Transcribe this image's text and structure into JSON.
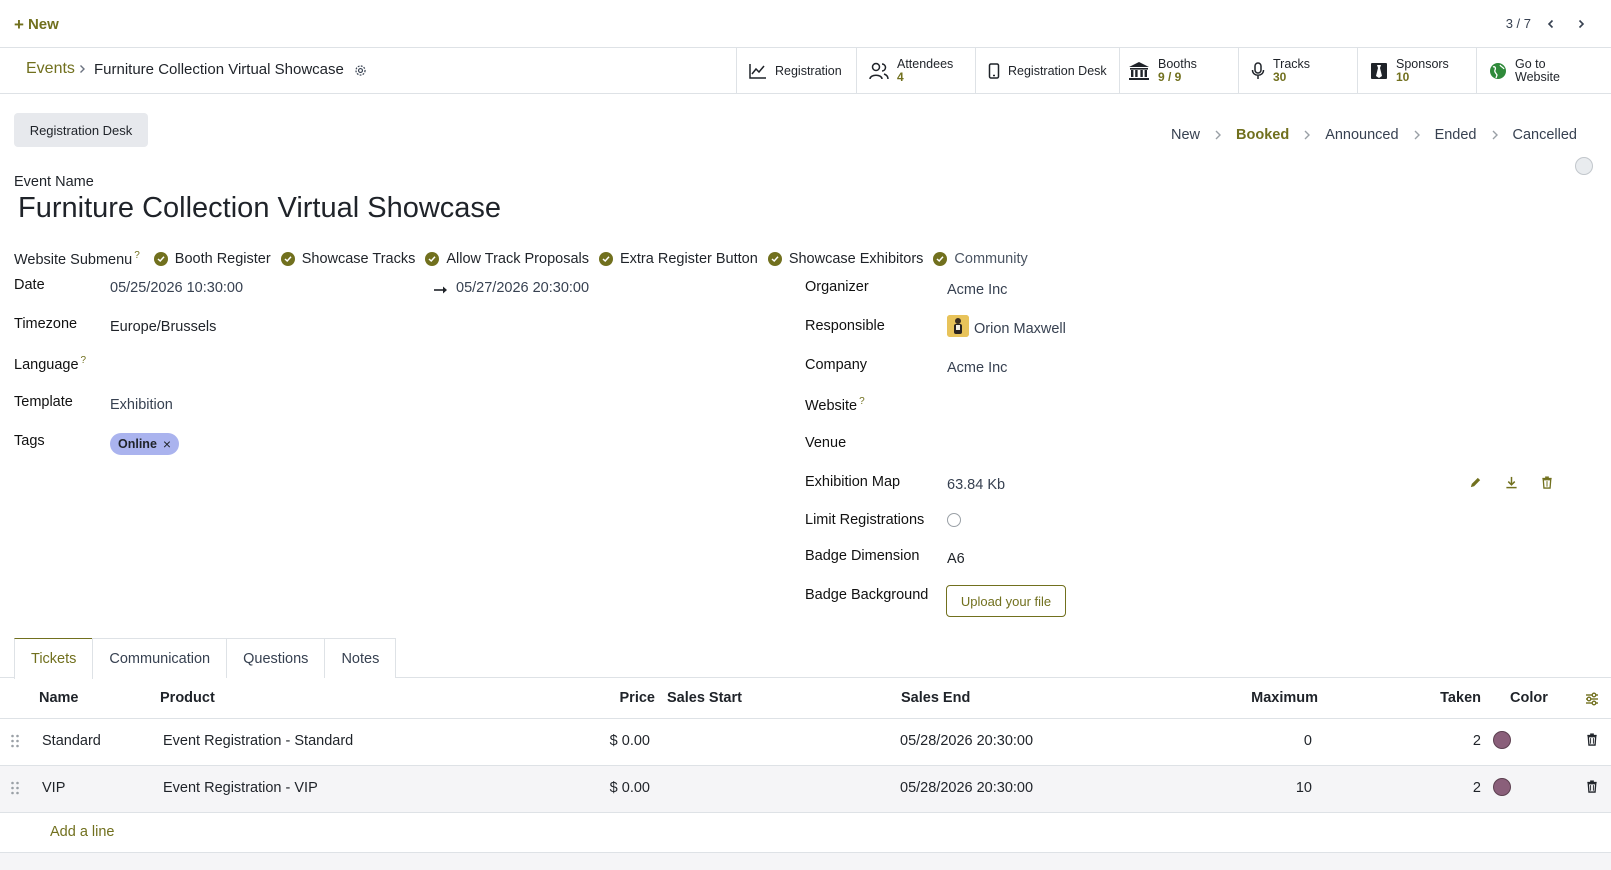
{
  "colors": {
    "accent": "#71701e",
    "tag_bg": "#aab3ee",
    "ticket_color": "#8a5f7a"
  },
  "control_panel": {
    "new_label": "New",
    "pager": "3 / 7"
  },
  "breadcrumb": {
    "parent": "Events",
    "current": "Furniture Collection Virtual Showcase"
  },
  "smart_buttons": {
    "registration": {
      "label": "Registration"
    },
    "attendees": {
      "label": "Attendees",
      "value": "4"
    },
    "registration_desk": {
      "label": "Registration Desk"
    },
    "booths": {
      "label": "Booths",
      "value": "9 / 9"
    },
    "tracks": {
      "label": "Tracks",
      "value": "30"
    },
    "sponsors": {
      "label": "Sponsors",
      "value": "10"
    },
    "website": {
      "label_line1": "Go to",
      "label_line2": "Website"
    }
  },
  "actions": {
    "registration_desk": "Registration Desk"
  },
  "stages": [
    "New",
    "Booked",
    "Announced",
    "Ended",
    "Cancelled"
  ],
  "stage_active": "Booked",
  "form": {
    "name_label": "Event Name",
    "name": "Furniture Collection Virtual Showcase",
    "submenu_label": "Website Submenu",
    "submenu_help": "?",
    "submenu_items": [
      "Booth Register",
      "Showcase Tracks",
      "Allow Track Proposals",
      "Extra Register Button",
      "Showcase Exhibitors",
      "Community"
    ],
    "date_label": "Date",
    "date_begin": "05/25/2026 10:30:00",
    "date_end": "05/27/2026 20:30:00",
    "timezone_label": "Timezone",
    "timezone": "Europe/Brussels",
    "language_label": "Language",
    "language_help": "?",
    "template_label": "Template",
    "template": "Exhibition",
    "tags_label": "Tags",
    "tag": "Online",
    "organizer_label": "Organizer",
    "organizer": "Acme Inc",
    "responsible_label": "Responsible",
    "responsible": "Orion Maxwell",
    "company_label": "Company",
    "company": "Acme Inc",
    "website_label": "Website",
    "website_help": "?",
    "venue_label": "Venue",
    "map_label": "Exhibition Map",
    "map_size": "63.84 Kb",
    "limit_label": "Limit Registrations",
    "badge_dim_label": "Badge Dimension",
    "badge_dim": "A6",
    "badge_bg_label": "Badge Background",
    "upload_label": "Upload your file"
  },
  "tabs": [
    "Tickets",
    "Communication",
    "Questions",
    "Notes"
  ],
  "tickets": {
    "columns": [
      "Name",
      "Product",
      "Price",
      "Sales Start",
      "Sales End",
      "Maximum",
      "Taken",
      "Color"
    ],
    "rows": [
      {
        "name": "Standard",
        "product": "Event Registration - Standard",
        "price": "$ 0.00",
        "sales_start": "",
        "sales_end": "05/28/2026 20:30:00",
        "maximum": "0",
        "taken": "2"
      },
      {
        "name": "VIP",
        "product": "Event Registration - VIP",
        "price": "$ 0.00",
        "sales_start": "",
        "sales_end": "05/28/2026 20:30:00",
        "maximum": "10",
        "taken": "2"
      }
    ],
    "add_line": "Add a line"
  }
}
